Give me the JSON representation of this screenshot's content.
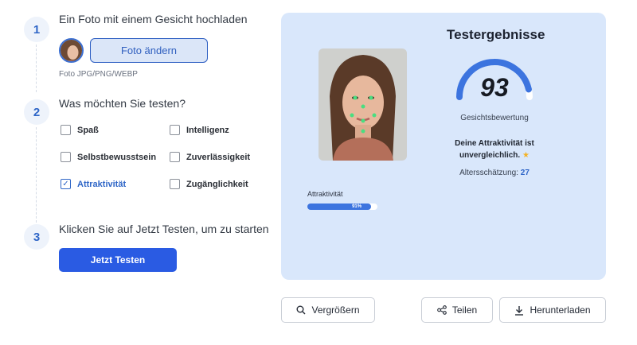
{
  "steps": {
    "step1": {
      "number": "1",
      "title": "Ein Foto mit einem Gesicht hochladen"
    },
    "step2": {
      "number": "2",
      "title": "Was möchten Sie testen?"
    },
    "step3": {
      "number": "3",
      "title": "Klicken Sie auf Jetzt Testen, um zu starten"
    }
  },
  "upload": {
    "change_label": "Foto ändern",
    "hint": "Foto JPG/PNG/WEBP"
  },
  "options": [
    {
      "label": "Spaß",
      "checked": false
    },
    {
      "label": "Intelligenz",
      "checked": false
    },
    {
      "label": "Selbstbewusstsein",
      "checked": false
    },
    {
      "label": "Zuverlässigkeit",
      "checked": false
    },
    {
      "label": "Attraktivität",
      "checked": true
    },
    {
      "label": "Zugänglichkeit",
      "checked": false
    }
  ],
  "start_label": "Jetzt Testen",
  "results": {
    "title": "Testergebnisse",
    "score": "93",
    "score_fraction": 0.93,
    "score_label": "Gesichtsbewertung",
    "message": "Deine Attraktivität ist unvergleichlich.",
    "star_icon": "★",
    "age_label": "Altersschätzung:",
    "age_value": "27",
    "bar_label": "Attraktivität",
    "bar_percent_text": "91%",
    "bar_fraction": 0.91
  },
  "actions": {
    "zoom_label": "Vergrößern",
    "share_label": "Teilen",
    "download_label": "Herunterladen"
  },
  "colors": {
    "accent": "#2a5be3",
    "panel": "#d9e7fb",
    "landmark": "#4ade80"
  }
}
